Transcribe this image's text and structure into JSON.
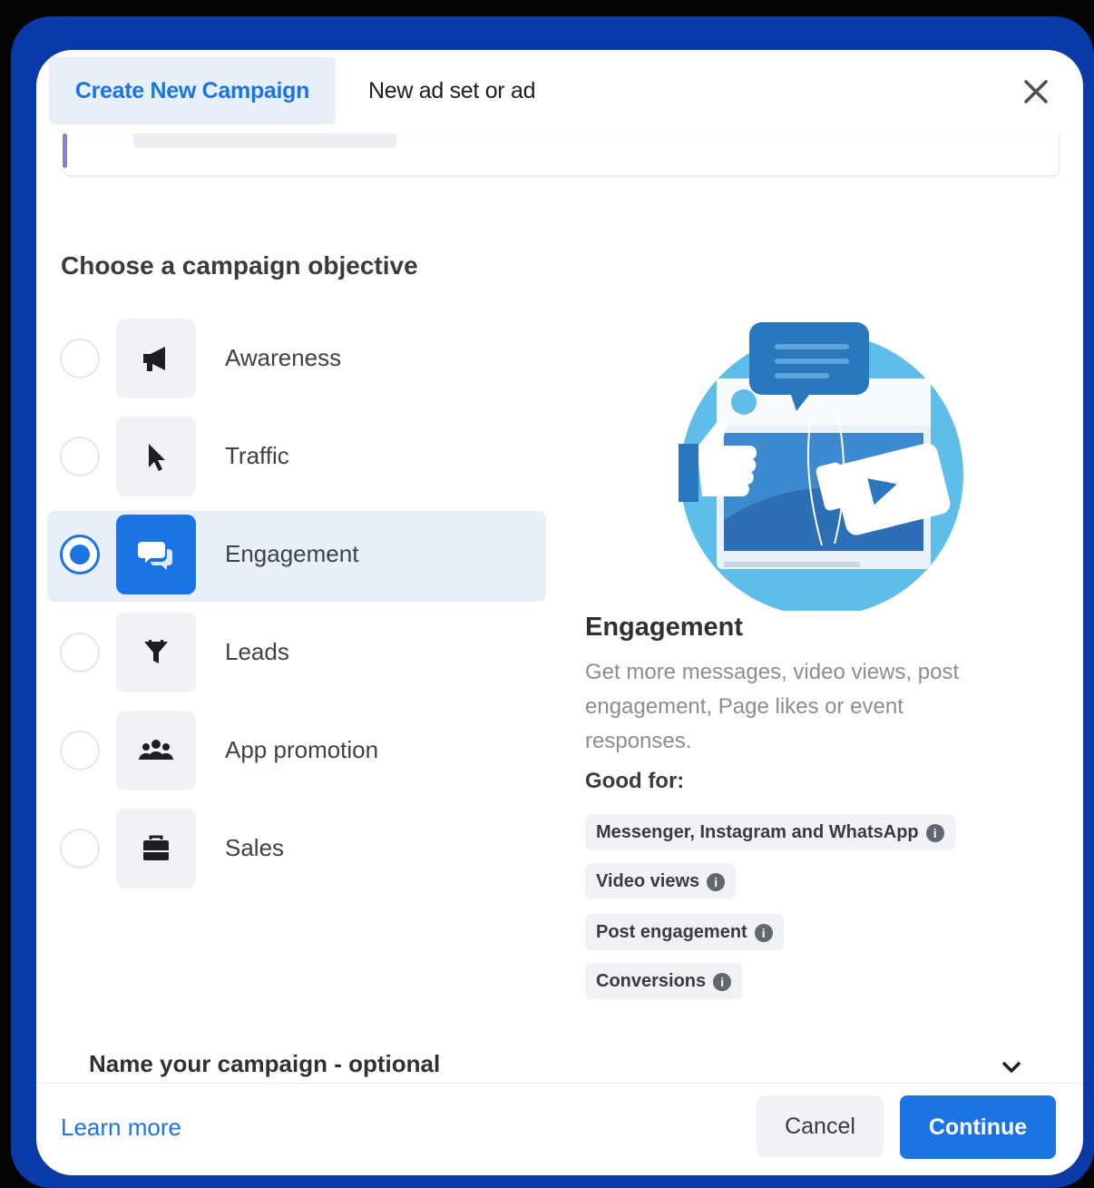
{
  "tabs": [
    {
      "label": "Create New Campaign",
      "active": true
    },
    {
      "label": "New ad set or ad",
      "active": false
    }
  ],
  "section_title": "Choose a campaign objective",
  "objectives": [
    {
      "label": "Awareness",
      "icon": "megaphone-icon",
      "selected": false
    },
    {
      "label": "Traffic",
      "icon": "cursor-icon",
      "selected": false
    },
    {
      "label": "Engagement",
      "icon": "chat-bubbles-icon",
      "selected": true
    },
    {
      "label": "Leads",
      "icon": "funnel-icon",
      "selected": false
    },
    {
      "label": "App promotion",
      "icon": "people-icon",
      "selected": false
    },
    {
      "label": "Sales",
      "icon": "briefcase-icon",
      "selected": false
    }
  ],
  "detail": {
    "title": "Engagement",
    "description": "Get more messages, video views, post engagement, Page likes or event responses.",
    "good_for_label": "Good for:",
    "good_for": [
      "Messenger, Instagram and WhatsApp",
      "Video views",
      "Post engagement",
      "Conversions"
    ]
  },
  "name_campaign": "Name your campaign - optional",
  "footer": {
    "learn_more": "Learn more",
    "cancel": "Cancel",
    "continue": "Continue"
  },
  "colors": {
    "accent": "#1b74e4",
    "frame": "#0a3aa8",
    "selected_bg": "#e7effb"
  }
}
